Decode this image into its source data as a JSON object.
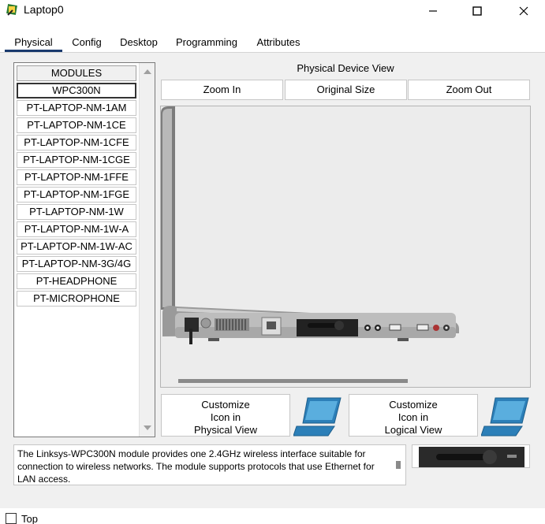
{
  "window": {
    "title": "Laptop0",
    "icon": "packet-tracer-icon",
    "controls": [
      "minimize-icon",
      "maximize-icon",
      "close-icon"
    ]
  },
  "tabs": [
    {
      "label": "Physical",
      "active": true
    },
    {
      "label": "Config",
      "active": false
    },
    {
      "label": "Desktop",
      "active": false
    },
    {
      "label": "Programming",
      "active": false
    },
    {
      "label": "Attributes",
      "active": false
    }
  ],
  "modules": {
    "header": "MODULES",
    "items": [
      "WPC300N",
      "PT-LAPTOP-NM-1AM",
      "PT-LAPTOP-NM-1CE",
      "PT-LAPTOP-NM-1CFE",
      "PT-LAPTOP-NM-1CGE",
      "PT-LAPTOP-NM-1FFE",
      "PT-LAPTOP-NM-1FGE",
      "PT-LAPTOP-NM-1W",
      "PT-LAPTOP-NM-1W-A",
      "PT-LAPTOP-NM-1W-AC",
      "PT-LAPTOP-NM-3G/4G",
      "PT-HEADPHONE",
      "PT-MICROPHONE"
    ],
    "selected": "WPC300N"
  },
  "device_view": {
    "label": "Physical Device View",
    "zoom_in": "Zoom In",
    "original_size": "Original Size",
    "zoom_out": "Zoom Out"
  },
  "customize": {
    "physical": {
      "line1": "Customize",
      "line2": "Icon in",
      "line3": "Physical View"
    },
    "logical": {
      "line1": "Customize",
      "line2": "Icon in",
      "line3": "Logical View"
    }
  },
  "description": "The Linksys-WPC300N module provides one 2.4GHz wireless interface suitable for connection to wireless networks. The module supports protocols that use Ethernet for LAN access.",
  "bottom": {
    "checkbox_label": "Top",
    "checked": false
  },
  "colors": {
    "tab_underline": "#1a3a6e",
    "panel_bg": "#f0f0f0",
    "laptop_icon": "#2c7fb8"
  }
}
